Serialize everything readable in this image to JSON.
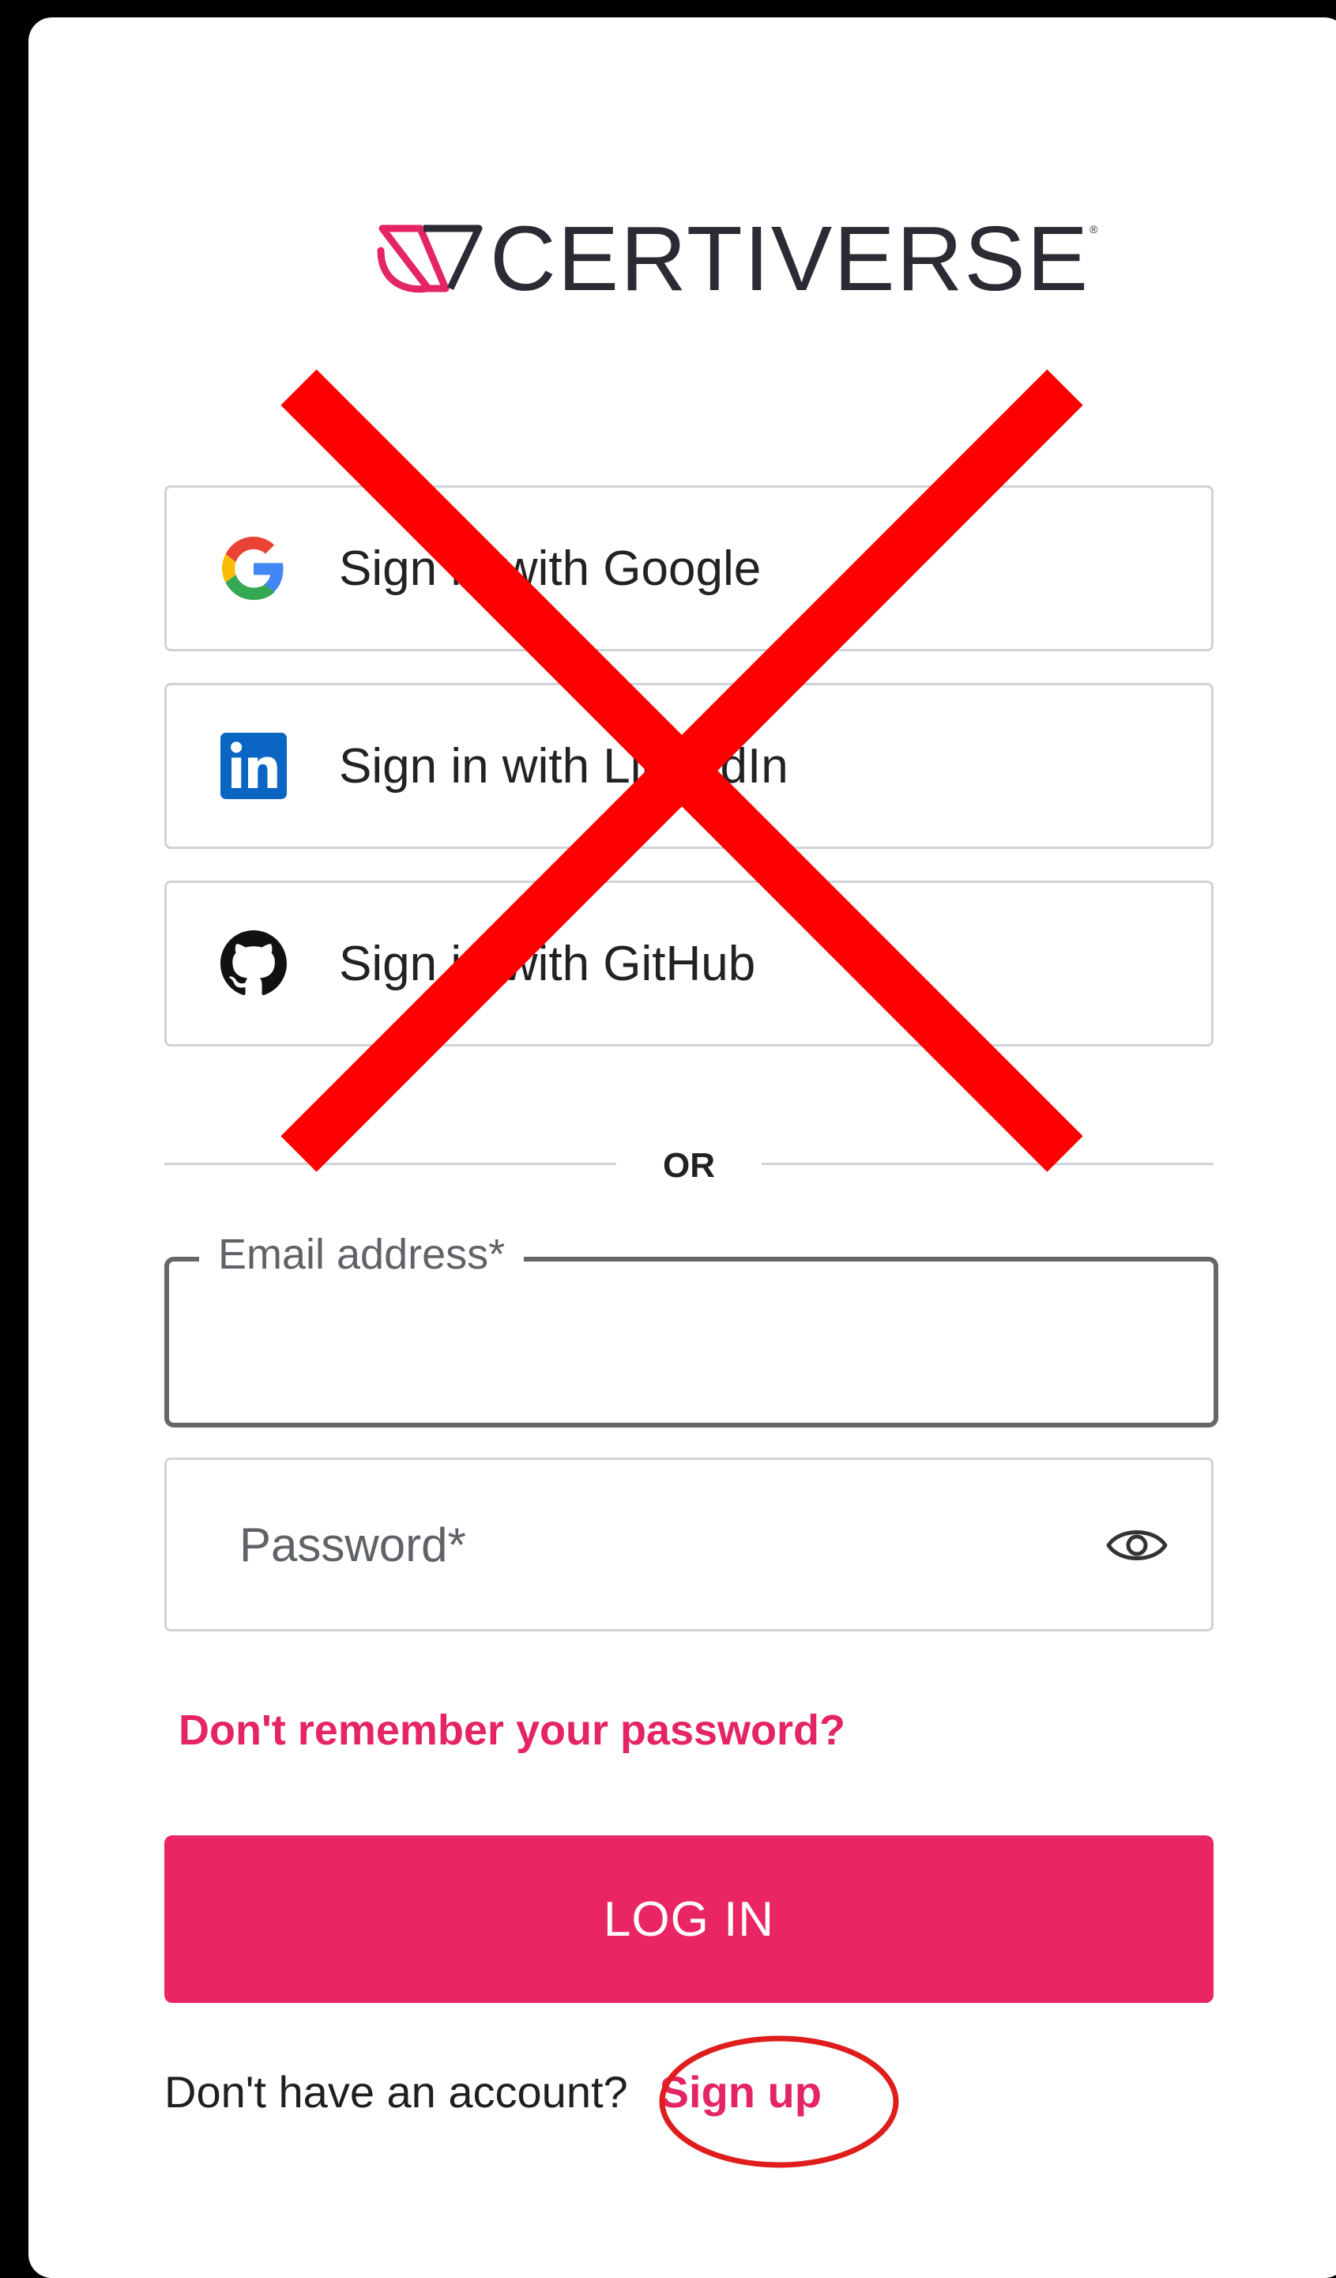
{
  "brand": {
    "name": "CERTIVERSE",
    "logo_icon": "certiverse-mark-icon",
    "accent_color": "#ea2563"
  },
  "sso": [
    {
      "label": "Sign in with Google",
      "icon": "google-icon"
    },
    {
      "label": "Sign in with LinkedIn",
      "icon": "linkedin-icon"
    },
    {
      "label": "Sign in with GitHub",
      "icon": "github-icon"
    }
  ],
  "divider_text": "OR",
  "email": {
    "label": "Email address*",
    "value": ""
  },
  "password": {
    "placeholder": "Password*",
    "value": "",
    "toggle_icon": "eye-icon"
  },
  "forgot_link": "Don't remember your password?",
  "login_button": "LOG IN",
  "signup": {
    "prompt": "Don't have an account?",
    "link": "Sign up"
  },
  "annotations": {
    "x_mark_color": "#ff0000",
    "circle_color": "#e01d1d"
  }
}
